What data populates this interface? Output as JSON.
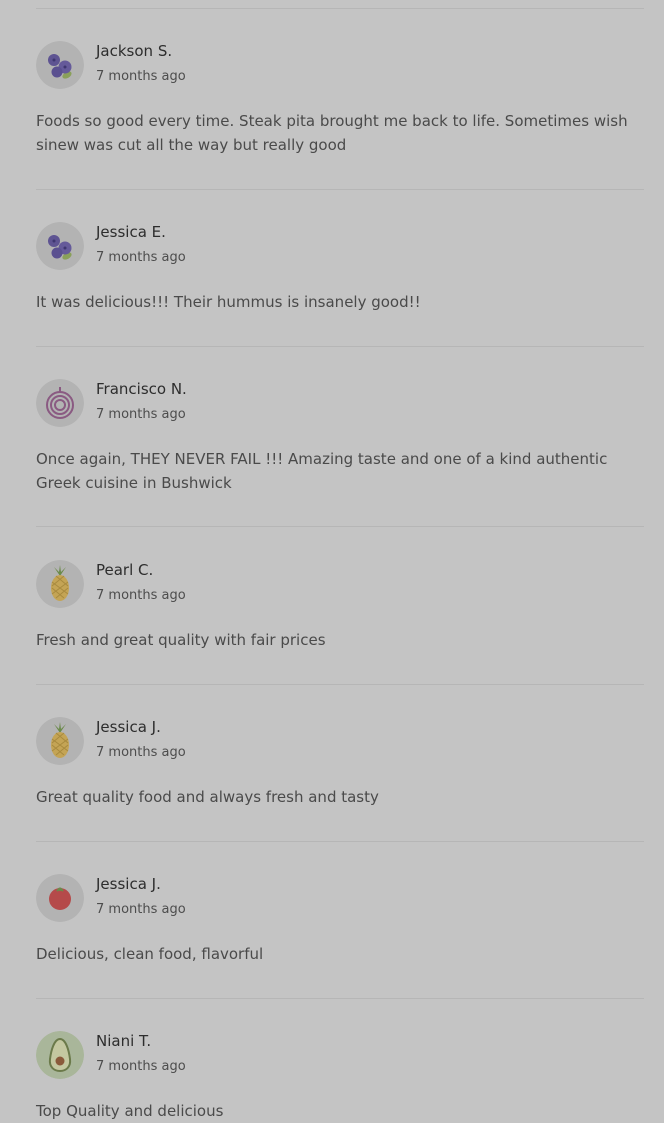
{
  "reviews": [
    {
      "name": "Jackson S.",
      "date": "7 months ago",
      "text": "Foods so good every time. Steak pita brought me back to life. Sometimes wish sinew was cut all the way but really good",
      "avatar": "blueberries-icon"
    },
    {
      "name": "Jessica E.",
      "date": "7 months ago",
      "text": "It was delicious!!! Their hummus is insanely good!!",
      "avatar": "blueberries-icon"
    },
    {
      "name": "Francisco N.",
      "date": "7 months ago",
      "text": "Once again, THEY NEVER FAIL !!! Amazing taste and one of a kind authentic Greek cuisine in Bushwick",
      "avatar": "onion-icon"
    },
    {
      "name": "Pearl C.",
      "date": "7 months ago",
      "text": "Fresh and great quality with fair prices",
      "avatar": "pineapple-icon"
    },
    {
      "name": "Jessica J.",
      "date": "7 months ago",
      "text": "Great quality food and always fresh and tasty",
      "avatar": "pineapple-icon"
    },
    {
      "name": "Jessica J.",
      "date": "7 months ago",
      "text": "Delicious, clean food, flavorful",
      "avatar": "tomato-icon"
    },
    {
      "name": "Niani T.",
      "date": "7 months ago",
      "text": "Top Quality and delicious",
      "avatar": "avocado-icon"
    }
  ],
  "colors": {
    "overlay_background": "#c4c4c4",
    "divider": "#b6b6b6"
  }
}
